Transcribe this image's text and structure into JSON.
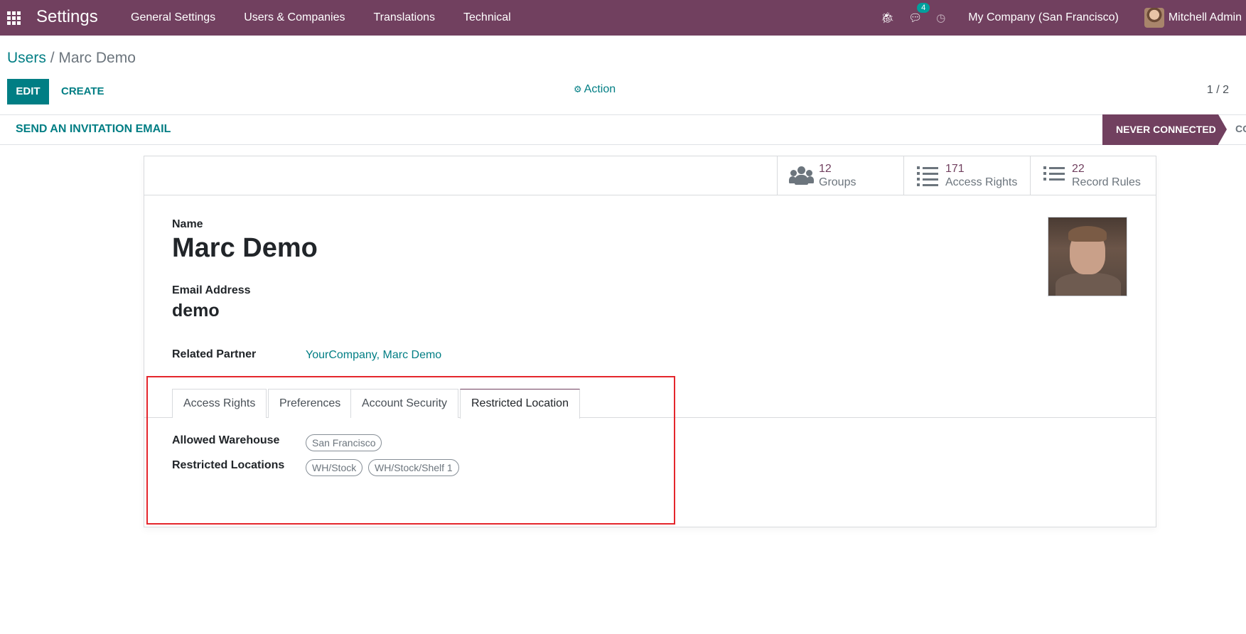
{
  "navbar": {
    "app_title": "Settings",
    "menu": [
      "General Settings",
      "Users & Companies",
      "Translations",
      "Technical"
    ],
    "messages_count": "4",
    "company": "My Company (San Francisco)",
    "user": "Mitchell Admin"
  },
  "breadcrumb": {
    "parent": "Users",
    "separator": "/",
    "current": "Marc Demo"
  },
  "toolbar": {
    "edit_label": "EDIT",
    "create_label": "CREATE",
    "action_label": "Action",
    "pager": "1 / 2"
  },
  "statusbar": {
    "invite_label": "SEND AN INVITATION EMAIL",
    "active_state": "NEVER CONNECTED",
    "next_state": "CO"
  },
  "smart_buttons": [
    {
      "count": "12",
      "label": "Groups",
      "icon": "users-icon"
    },
    {
      "count": "171",
      "label": "Access Rights",
      "icon": "list-icon"
    },
    {
      "count": "22",
      "label": "Record Rules",
      "icon": "list-icon"
    }
  ],
  "form": {
    "name_label": "Name",
    "name_value": "Marc Demo",
    "email_label": "Email Address",
    "email_value": "demo",
    "partner_label": "Related Partner",
    "partner_value": "YourCompany, Marc Demo"
  },
  "tabs": [
    "Access Rights",
    "Preferences",
    "Account Security",
    "Restricted Location"
  ],
  "active_tab": "Restricted Location",
  "restricted": {
    "warehouse_label": "Allowed Warehouse",
    "warehouse_tags": [
      "San Francisco"
    ],
    "locations_label": "Restricted Locations",
    "location_tags": [
      "WH/Stock",
      "WH/Stock/Shelf 1"
    ]
  },
  "colors": {
    "brand": "#71405f",
    "accent": "#017e84",
    "highlight": "#e4262c"
  }
}
